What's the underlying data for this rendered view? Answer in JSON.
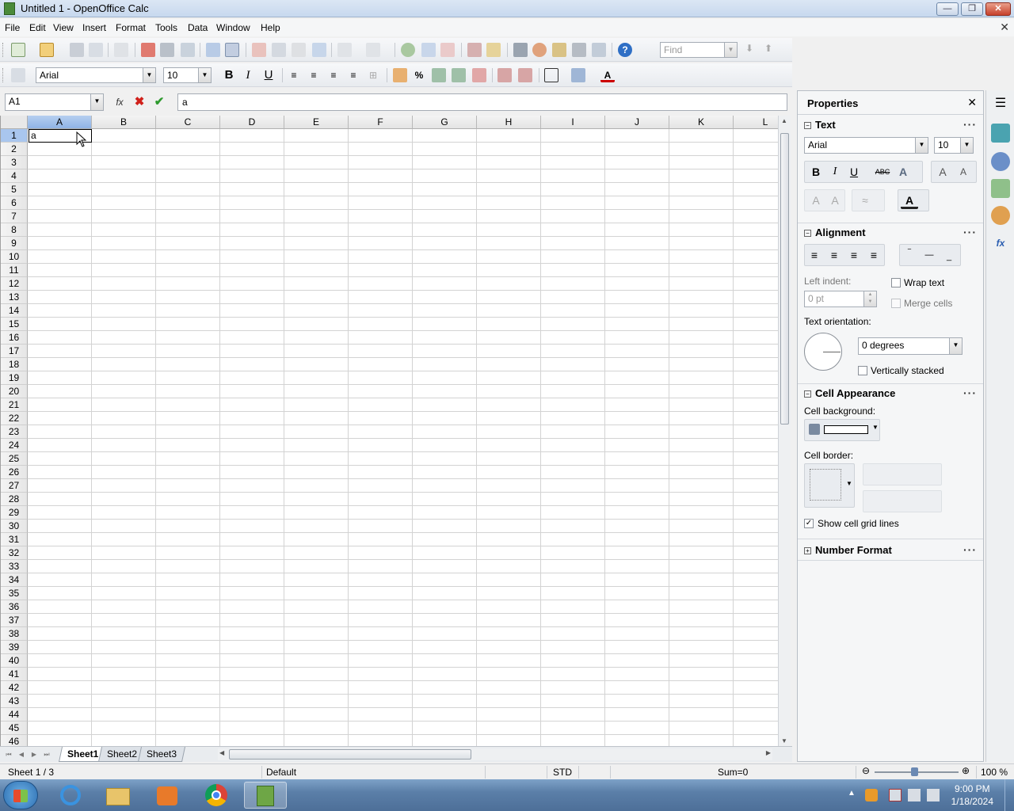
{
  "window": {
    "title": "Untitled 1 - OpenOffice Calc",
    "controls": [
      "—",
      "❐",
      "✕"
    ]
  },
  "menu": [
    "File",
    "Edit",
    "View",
    "Insert",
    "Format",
    "Tools",
    "Data",
    "Window",
    "Help"
  ],
  "toolbar": {
    "find_placeholder": "Find",
    "font_name": "Arial",
    "font_size": "10"
  },
  "formula_bar": {
    "name_box": "A1",
    "content": "a"
  },
  "sheet": {
    "columns": [
      "A",
      "B",
      "C",
      "D",
      "E",
      "F",
      "G",
      "H",
      "I",
      "J",
      "K",
      "L"
    ],
    "rows": [
      "1",
      "2",
      "3",
      "4",
      "5",
      "6",
      "7",
      "8",
      "9",
      "10",
      "11",
      "12",
      "13",
      "14",
      "15",
      "16",
      "17",
      "18",
      "19",
      "20",
      "21",
      "22",
      "23",
      "24",
      "25",
      "26",
      "27",
      "28",
      "29",
      "30",
      "31",
      "32",
      "33",
      "34",
      "35",
      "36",
      "37",
      "38",
      "39",
      "40",
      "41",
      "42",
      "43",
      "44",
      "45",
      "46"
    ],
    "active_cell": "A1",
    "cell_a1": "a",
    "tabs": [
      "Sheet1",
      "Sheet2",
      "Sheet3"
    ],
    "active_tab": "Sheet1"
  },
  "status": {
    "sheet": "Sheet 1 / 3",
    "style": "Default",
    "mode": "STD",
    "sum": "Sum=0",
    "zoom": "100 %",
    "zoom_level": 100
  },
  "sidebar": {
    "title": "Properties",
    "text": {
      "header": "Text",
      "font": "Arial",
      "size": "10"
    },
    "alignment": {
      "header": "Alignment",
      "left_indent_label": "Left indent:",
      "left_indent_value": "0 pt",
      "wrap_text": "Wrap text",
      "merge_cells": "Merge cells",
      "text_orientation_label": "Text orientation:",
      "orientation_value": "0 degrees",
      "vertically_stacked": "Vertically stacked"
    },
    "cell_appearance": {
      "header": "Cell Appearance",
      "background_label": "Cell background:",
      "border_label": "Cell border:",
      "show_grid_lines": "Show cell grid lines"
    },
    "number_format": {
      "header": "Number Format"
    }
  },
  "taskbar": {
    "time": "9:00 PM",
    "date": "1/18/2024"
  }
}
